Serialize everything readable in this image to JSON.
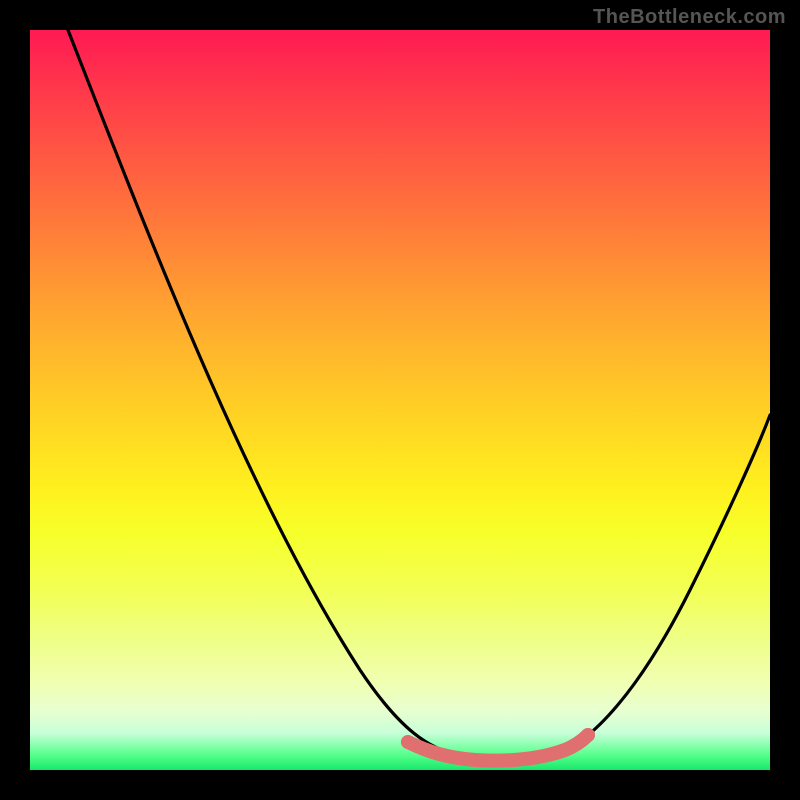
{
  "watermark": "TheBottleneck.com",
  "chart_data": {
    "type": "line",
    "title": "",
    "xlabel": "",
    "ylabel": "",
    "x_range": [
      0,
      100
    ],
    "y_range": [
      0,
      100
    ],
    "series": [
      {
        "name": "curve",
        "color": "#000000",
        "points": [
          {
            "x": 5,
            "y": 100
          },
          {
            "x": 10,
            "y": 88
          },
          {
            "x": 15,
            "y": 76
          },
          {
            "x": 20,
            "y": 64
          },
          {
            "x": 25,
            "y": 52
          },
          {
            "x": 30,
            "y": 40
          },
          {
            "x": 35,
            "y": 28
          },
          {
            "x": 40,
            "y": 18
          },
          {
            "x": 45,
            "y": 10
          },
          {
            "x": 50,
            "y": 4
          },
          {
            "x": 55,
            "y": 1
          },
          {
            "x": 60,
            "y": 0
          },
          {
            "x": 65,
            "y": 0
          },
          {
            "x": 70,
            "y": 1
          },
          {
            "x": 75,
            "y": 4
          },
          {
            "x": 80,
            "y": 10
          },
          {
            "x": 85,
            "y": 18
          },
          {
            "x": 90,
            "y": 27
          },
          {
            "x": 95,
            "y": 37
          },
          {
            "x": 100,
            "y": 48
          }
        ]
      },
      {
        "name": "bottom-highlight",
        "color": "#e57373",
        "points": [
          {
            "x": 50,
            "y": 4
          },
          {
            "x": 53,
            "y": 2
          },
          {
            "x": 55,
            "y": 1
          },
          {
            "x": 60,
            "y": 0
          },
          {
            "x": 65,
            "y": 0
          },
          {
            "x": 68,
            "y": 1
          },
          {
            "x": 71,
            "y": 2
          },
          {
            "x": 73,
            "y": 4
          }
        ]
      }
    ],
    "annotations": []
  }
}
